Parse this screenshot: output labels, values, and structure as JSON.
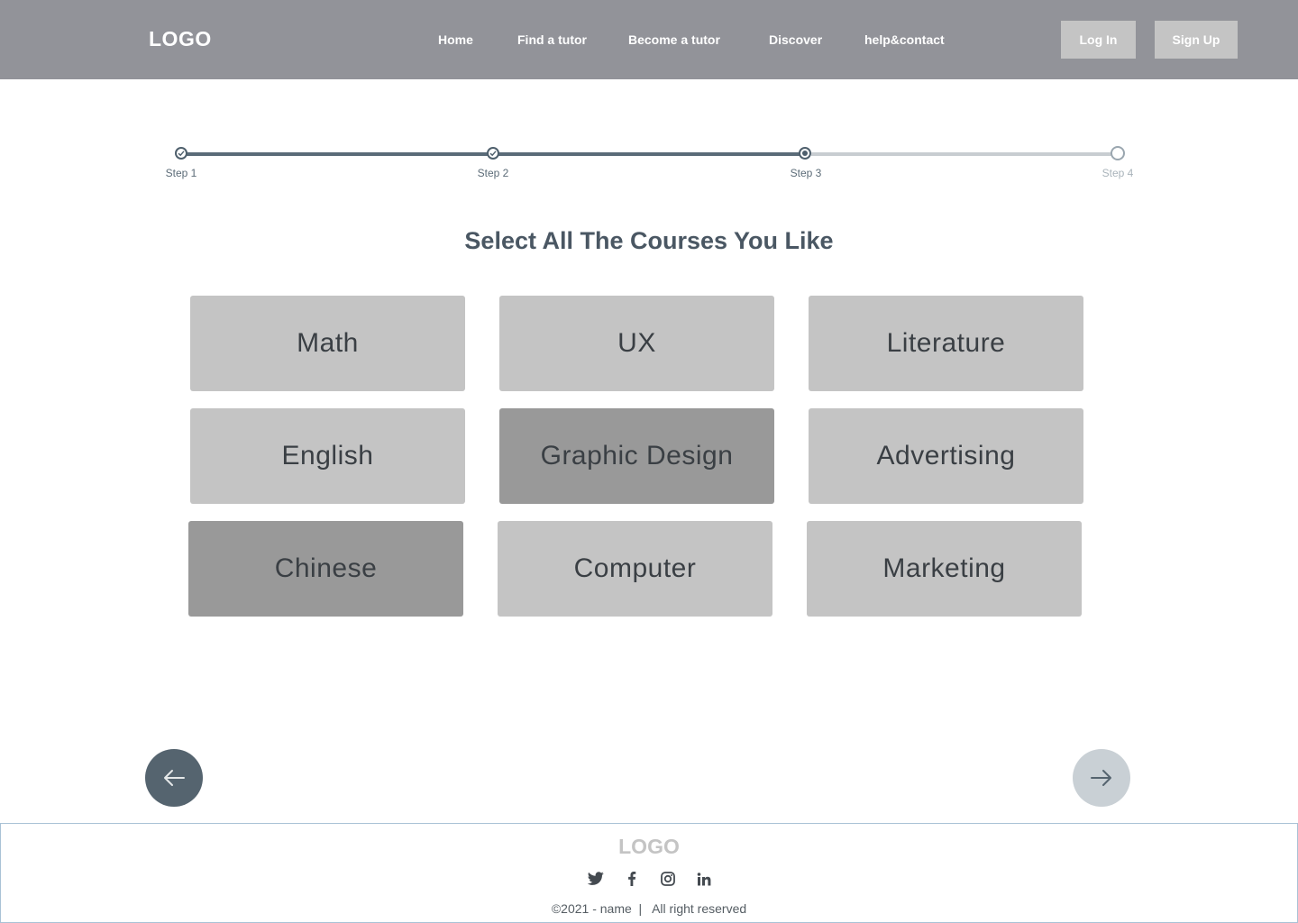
{
  "header": {
    "logo": "LOGO",
    "nav": [
      "Home",
      "Find a tutor",
      "Become a tutor",
      "Discover",
      "help&contact"
    ],
    "login_label": "Log In",
    "signup_label": "Sign Up"
  },
  "stepper": {
    "steps": [
      "Step 1",
      "Step 2",
      "Step 3",
      "Step 4"
    ],
    "current_step": 3
  },
  "page_title": "Select All The Courses You Like",
  "courses": [
    {
      "label": "Math",
      "selected": false
    },
    {
      "label": "UX",
      "selected": false
    },
    {
      "label": "Literature",
      "selected": false
    },
    {
      "label": "English",
      "selected": false
    },
    {
      "label": "Graphic Design",
      "selected": true
    },
    {
      "label": "Advertising",
      "selected": false
    },
    {
      "label": "Chinese",
      "selected": true
    },
    {
      "label": "Computer",
      "selected": false
    },
    {
      "label": "Marketing",
      "selected": false
    }
  ],
  "navigation": {
    "prev_icon": "arrow-left-icon",
    "next_icon": "arrow-right-icon"
  },
  "footer": {
    "logo": "LOGO",
    "social_icons": [
      "twitter-icon",
      "facebook-icon",
      "instagram-icon",
      "linkedin-icon"
    ],
    "copyright": "©2021 - name  |   All right reserved"
  },
  "colors": {
    "header_bg": "#929399",
    "tile_bg": "#c4c4c4",
    "tile_selected_bg": "#999999",
    "accent_dark": "#55646f",
    "accent_light": "#c9d0d5"
  }
}
